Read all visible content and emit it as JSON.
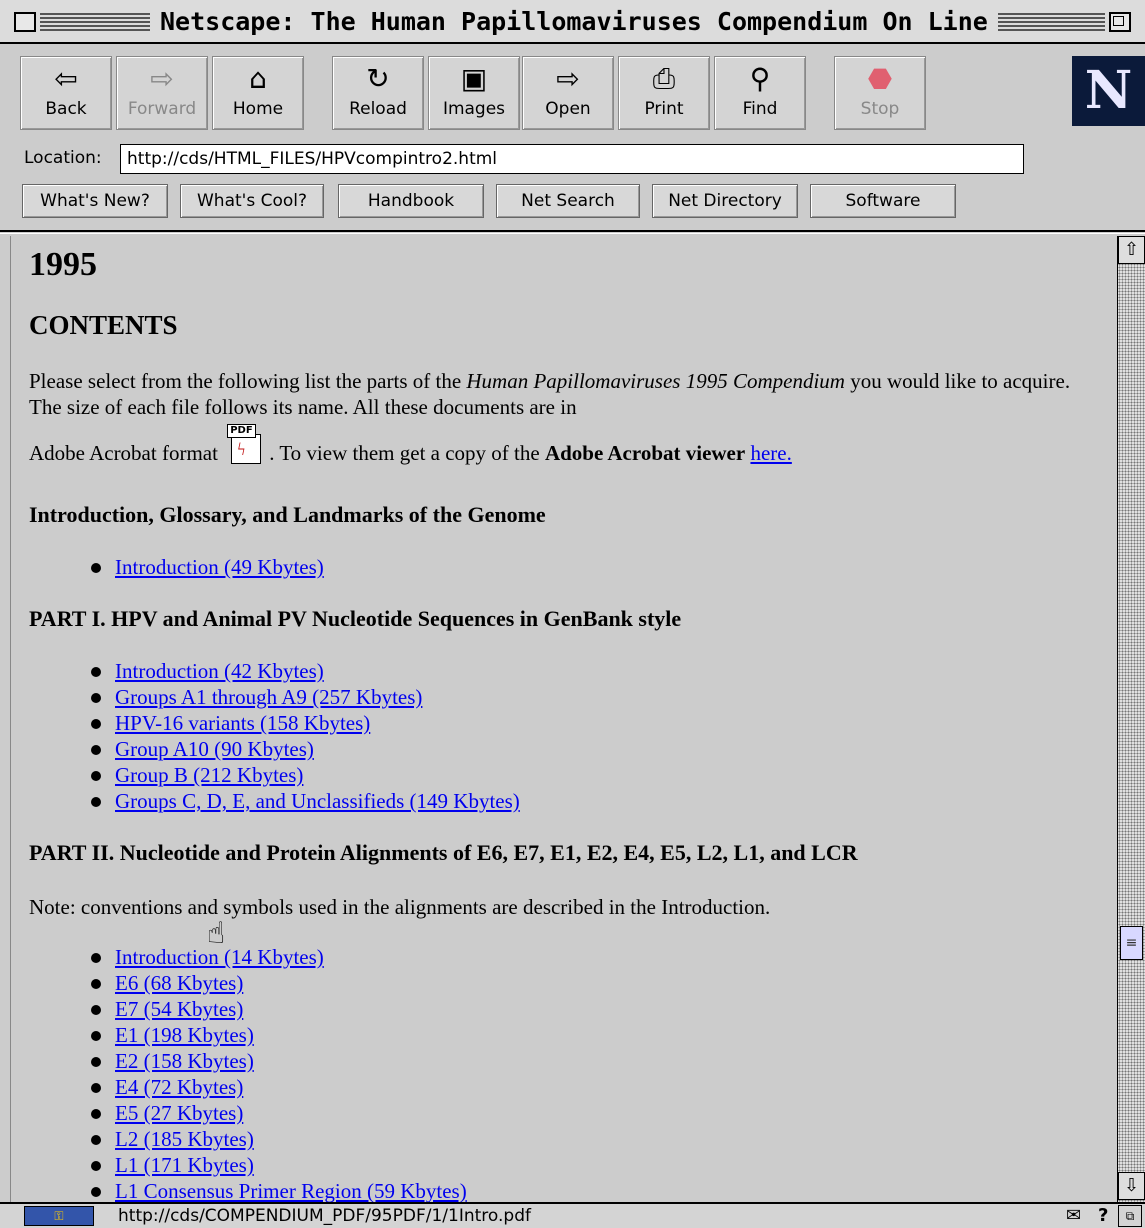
{
  "window": {
    "title": "Netscape: The Human Papillomaviruses Compendium On Line"
  },
  "toolbar": {
    "buttons": [
      {
        "label": "Back",
        "icon": "back-arrow-icon",
        "glyph": "⇦"
      },
      {
        "label": "Forward",
        "icon": "forward-arrow-icon",
        "glyph": "⇨",
        "disabled": true
      },
      {
        "label": "Home",
        "icon": "home-icon",
        "glyph": "⌂"
      },
      {
        "label": "Reload",
        "icon": "reload-icon",
        "glyph": "↻"
      },
      {
        "label": "Images",
        "icon": "images-icon",
        "glyph": "▣"
      },
      {
        "label": "Open",
        "icon": "open-icon",
        "glyph": "⇨"
      },
      {
        "label": "Print",
        "icon": "print-icon",
        "glyph": "⎙"
      },
      {
        "label": "Find",
        "icon": "find-icon",
        "glyph": "⚲"
      },
      {
        "label": "Stop",
        "icon": "stop-icon",
        "glyph": "⬣",
        "disabled": true
      }
    ],
    "logo": "N"
  },
  "location": {
    "label": "Location:",
    "url": "http://cds/HTML_FILES/HPVcompintro2.html"
  },
  "directory": {
    "buttons": [
      "What's New?",
      "What's Cool?",
      "Handbook",
      "Net Search",
      "Net Directory",
      "Software"
    ]
  },
  "content": {
    "heading_year": "1995",
    "heading_contents": "CONTENTS",
    "intro_text_1": "Please select from the following list the parts of the ",
    "intro_italic": "Human Papillomaviruses 1995 Compendium",
    "intro_text_2": " you would like to acquire. The size of each file follows its name. All these documents are in",
    "acrobat_text_1": "Adobe Acrobat format ",
    "pdf_icon_label": "PDF",
    "acrobat_text_2": ". To view them get a copy of the ",
    "acrobat_bold": "Adobe Acrobat viewer",
    "acrobat_link": "here.",
    "section_intro": "Introduction, Glossary, and Landmarks of the Genome",
    "section_intro_items": [
      "Introduction (49 Kbytes)"
    ],
    "section_part1": "PART I. HPV and Animal PV Nucleotide Sequences in GenBank style",
    "section_part1_items": [
      "Introduction (42 Kbytes)",
      "Groups A1 through A9 (257 Kbytes)",
      "HPV-16 variants (158 Kbytes)",
      "Group A10 (90 Kbytes)",
      "Group B (212 Kbytes)",
      "Groups C, D, E, and Unclassifieds (149 Kbytes)"
    ],
    "section_part2": "PART II. Nucleotide and Protein Alignments of E6, E7, E1, E2, E4, E5, L2, L1, and LCR",
    "part2_note": "Note: conventions and symbols used in the alignments are described in the Introduction.",
    "section_part2_items": [
      "Introduction (14 Kbytes)",
      "E6 (68 Kbytes)",
      "E7 (54 Kbytes)",
      "E1 (198 Kbytes)",
      "E2 (158 Kbytes)",
      "E4 (72 Kbytes)",
      "E5 (27 Kbytes)",
      "L2 (185 Kbytes)",
      "L1 (171 Kbytes)",
      "L1 Consensus Primer Region (59 Kbytes)"
    ]
  },
  "status": {
    "text": "http://cds/COMPENDIUM_PDF/95PDF/1/1Intro.pdf"
  },
  "colors": {
    "link": "#0000ee",
    "background": "#cccccc"
  }
}
